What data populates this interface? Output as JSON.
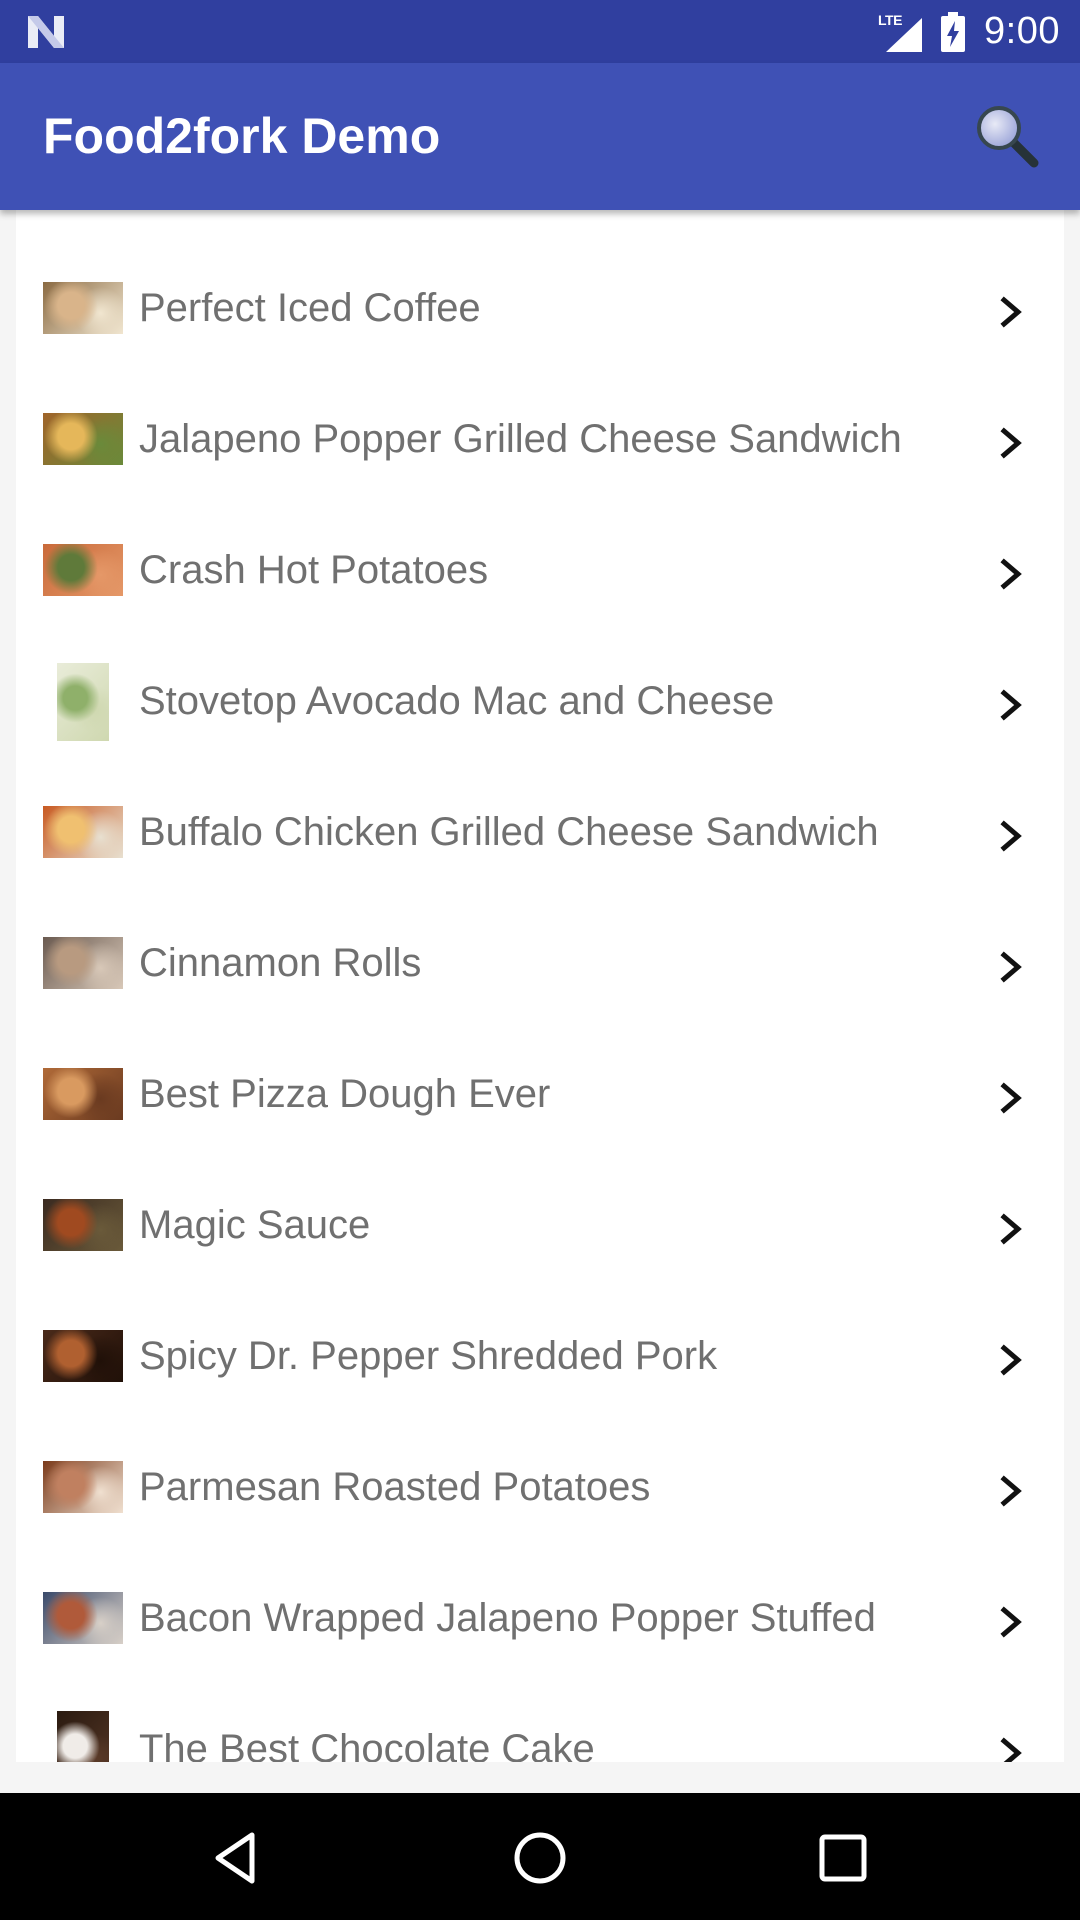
{
  "status_bar": {
    "network_type": "LTE",
    "time": "9:00"
  },
  "app_bar": {
    "title": "Food2fork Demo",
    "search_icon": "search-icon"
  },
  "recipes": [
    {
      "title": "Perfect Iced Coffee",
      "thumb_colors": [
        "#8a6a42",
        "#d9b48a",
        "#f1e6d0"
      ]
    },
    {
      "title": "Jalapeno Popper Grilled Cheese Sandwich",
      "thumb_colors": [
        "#a0642a",
        "#e5b75a",
        "#6a8a3a"
      ]
    },
    {
      "title": "Crash Hot Potatoes",
      "thumb_colors": [
        "#c96a3a",
        "#5f7a3a",
        "#e59868"
      ]
    },
    {
      "title": "Stovetop Avocado Mac and Cheese",
      "thumb_colors": [
        "#e9ecd9",
        "#8fb06a",
        "#cfd8b0"
      ],
      "tall": true
    },
    {
      "title": "Buffalo Chicken Grilled Cheese Sandwich",
      "thumb_colors": [
        "#c85a22",
        "#f0c070",
        "#e8e0d0"
      ]
    },
    {
      "title": "Cinnamon Rolls",
      "thumb_colors": [
        "#6a5a50",
        "#b89a80",
        "#d8c8b8"
      ]
    },
    {
      "title": "Best Pizza Dough Ever",
      "thumb_colors": [
        "#b06a38",
        "#d99a60",
        "#6a3a20"
      ]
    },
    {
      "title": "Magic Sauce",
      "thumb_colors": [
        "#3a2a20",
        "#a04a20",
        "#6a5a3a"
      ]
    },
    {
      "title": "Spicy Dr. Pepper Shredded Pork",
      "thumb_colors": [
        "#4a2a1a",
        "#b06030",
        "#201008"
      ]
    },
    {
      "title": "Parmesan Roasted Potatoes",
      "thumb_colors": [
        "#7a3a1a",
        "#c08060",
        "#f0e0d0"
      ]
    },
    {
      "title": "Bacon Wrapped Jalapeno Popper Stuffed",
      "thumb_colors": [
        "#3a4a6a",
        "#b05a3a",
        "#d8d0c8"
      ]
    },
    {
      "title": "The Best Chocolate Cake",
      "thumb_colors": [
        "#2a1a10",
        "#f0ece8",
        "#5a3a28"
      ],
      "tall": true
    }
  ],
  "nav_bar": {
    "back_icon": "back-icon",
    "home_icon": "home-icon",
    "recents_icon": "recents-icon"
  },
  "colors": {
    "status_bar": "#303F9F",
    "app_bar": "#3F51B5",
    "list_text": "#707070"
  }
}
